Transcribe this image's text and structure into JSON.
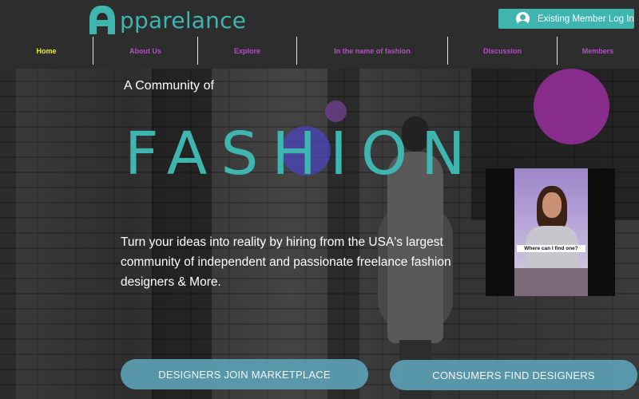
{
  "brand": {
    "logo_text": "pparelance",
    "logo_letter": "A",
    "accent": "#3fb5b0"
  },
  "header": {
    "login_label": "Existing Member Log In",
    "avatar_icon": "user-avatar-icon"
  },
  "nav": {
    "items": [
      {
        "label": "Home",
        "active": true
      },
      {
        "label": "About Us"
      },
      {
        "label": "Explore"
      },
      {
        "label": "In the name of fashion"
      },
      {
        "label": "Discussion"
      },
      {
        "label": "Members"
      }
    ],
    "active_color": "#e8e83a",
    "color": "#b34fc4"
  },
  "hero": {
    "subtitle": "A Community of",
    "title": "FASHION",
    "description": "Turn your ideas into reality by hiring from the USA's largest community of independent and passionate freelance fashion designers & More.",
    "video": {
      "caption": "Where can I find one?"
    },
    "buttons": {
      "designers": "DESIGNERS JOIN MARKETPLACE",
      "consumers": "CONSUMERS FIND DESIGNERS"
    }
  }
}
